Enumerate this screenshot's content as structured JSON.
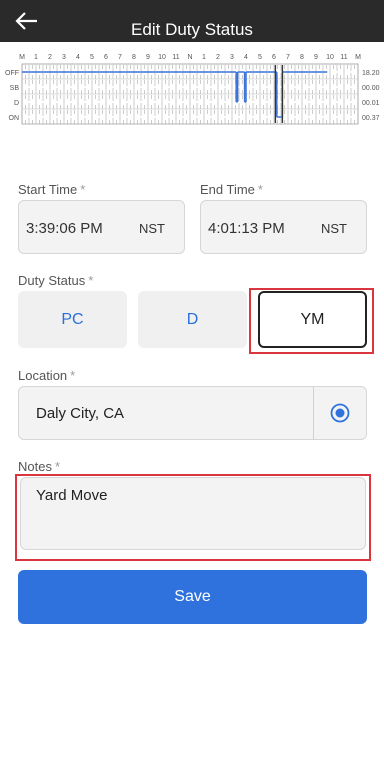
{
  "header": {
    "title": "Edit Duty Status",
    "back_icon": "arrow-left-icon"
  },
  "log_graph": {
    "hour_labels": [
      "M",
      "1",
      "2",
      "3",
      "4",
      "5",
      "6",
      "7",
      "8",
      "9",
      "10",
      "11",
      "N",
      "1",
      "2",
      "3",
      "4",
      "5",
      "6",
      "7",
      "8",
      "9",
      "10",
      "11",
      "M"
    ],
    "rows": [
      {
        "label": "OFF",
        "total": "18.20"
      },
      {
        "label": "SB",
        "total": "00.00"
      },
      {
        "label": "D",
        "total": "00.01"
      },
      {
        "label": "ON",
        "total": "00.37"
      }
    ],
    "line_color": "#3a72d6"
  },
  "start_time": {
    "label": "Start Time",
    "required": "*",
    "value": "3:39:06 PM",
    "timezone": "NST"
  },
  "end_time": {
    "label": "End Time",
    "required": "*",
    "value": "4:01:13 PM",
    "timezone": "NST"
  },
  "duty_status": {
    "label": "Duty Status",
    "required": "*",
    "options": [
      {
        "label": "PC",
        "selected": false
      },
      {
        "label": "D",
        "selected": false
      },
      {
        "label": "YM",
        "selected": true
      }
    ]
  },
  "location": {
    "label": "Location",
    "required": "*",
    "value": "Daly City, CA",
    "icon": "gps-target-icon"
  },
  "notes": {
    "label": "Notes",
    "required": "*",
    "value": "Yard Move"
  },
  "save": {
    "label": "Save"
  },
  "colors": {
    "accent": "#2f72de",
    "highlight": "#d9363e",
    "header_bg": "#2a2a2a"
  }
}
